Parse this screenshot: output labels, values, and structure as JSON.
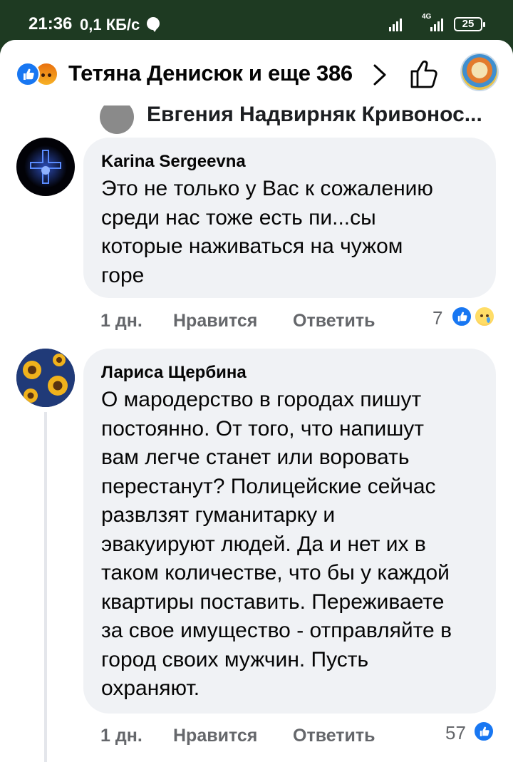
{
  "status_bar": {
    "time": "21:36",
    "speed": "0,1 КБ/с",
    "network": "4G",
    "battery": "25"
  },
  "header": {
    "likers": "Тетяна Денисюк и еще 386"
  },
  "previous_comment": {
    "name": "Евгения Надвирняк Кривонос..."
  },
  "comments": [
    {
      "author": "Karina Sergeevna",
      "text": "Это не только у Вас к сожалению\nсреди нас тоже есть пи...сы\nкоторые наживаться на чужом\nгоре",
      "time": "1 дн.",
      "like_label": "Нравится",
      "reply_label": "Ответить",
      "reaction_count": "7",
      "reactions": [
        "like-icon",
        "sad-icon"
      ]
    },
    {
      "author": "Лариса Щербина",
      "text": "О мародерство в городах пишут\nпостоянно. От того, что напишут\nвам легче станет или воровать\nперестанут? Полицейские сейчас\nразвлзят гуманитарку и\nэвакуируют людей. Да и нет их в\nтаком количестве, что бы у каждой\nквартиры поставить. Переживаете\nза свое имущество - отправляйте в\nгород своих мужчин. Пусть\nохраняют.",
      "time": "1 дн.",
      "like_label": "Нравится",
      "reply_label": "Ответить",
      "reaction_count": "57",
      "reactions": [
        "like-icon"
      ]
    }
  ],
  "colors": {
    "accent": "#1877f2",
    "bubble": "#f0f2f5",
    "meta": "#65676b",
    "status_bar": "#1e3a22"
  }
}
